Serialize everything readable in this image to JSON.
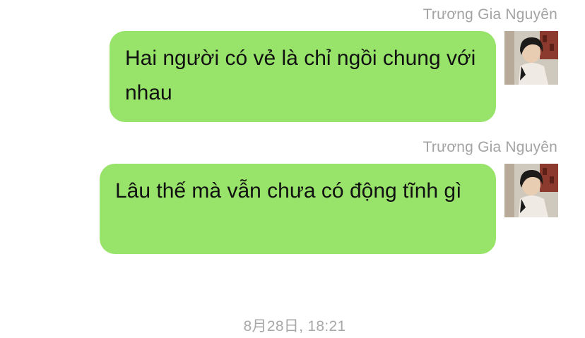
{
  "messages": [
    {
      "sender": "Trương Gia Nguyên",
      "text": "Hai người có vẻ là chỉ ngồi chung với nhau",
      "avatar_icon": "user-avatar-photo"
    },
    {
      "sender": "Trương Gia Nguyên",
      "text": "Lâu thế mà vẫn chưa có động tĩnh gì",
      "avatar_icon": "user-avatar-photo"
    }
  ],
  "timestamp": "8月28日, 18:21",
  "colors": {
    "bubble": "#98e46a",
    "name_text": "#a3a3a3",
    "timestamp_text": "#a8a8a8",
    "background": "#ffffff"
  }
}
